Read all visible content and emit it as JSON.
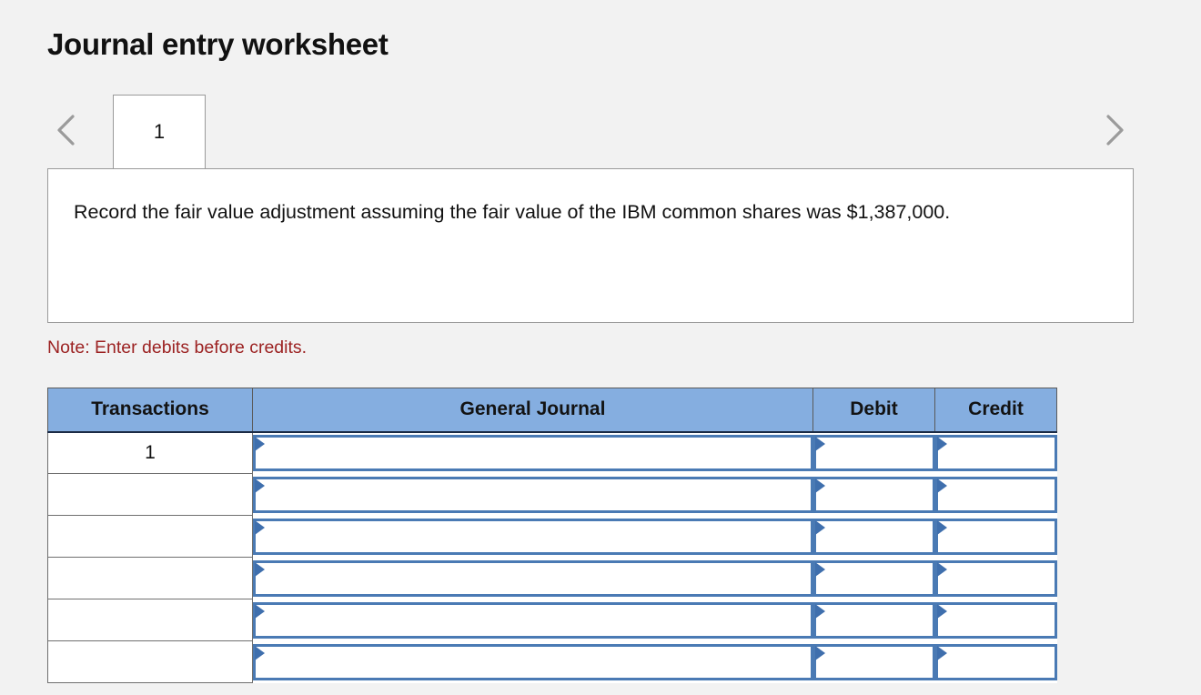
{
  "page_title": "Journal entry worksheet",
  "navigation": {
    "prev_label": "‹",
    "next_label": "›",
    "prev_icon": "chevron-left-icon",
    "next_icon": "chevron-right-icon",
    "tabs": [
      {
        "label": "1",
        "active": true
      }
    ]
  },
  "requirement": {
    "text": "Record the fair value adjustment assuming the fair value of the IBM common shares was $1,387,000."
  },
  "note": "Note: Enter debits before credits.",
  "table": {
    "headers": {
      "transactions": "Transactions",
      "general_journal": "General Journal",
      "debit": "Debit",
      "credit": "Credit"
    },
    "rows": [
      {
        "transaction": "1",
        "general_journal": "",
        "debit": "",
        "credit": ""
      },
      {
        "transaction": "",
        "general_journal": "",
        "debit": "",
        "credit": ""
      },
      {
        "transaction": "",
        "general_journal": "",
        "debit": "",
        "credit": ""
      },
      {
        "transaction": "",
        "general_journal": "",
        "debit": "",
        "credit": ""
      },
      {
        "transaction": "",
        "general_journal": "",
        "debit": "",
        "credit": ""
      },
      {
        "transaction": "",
        "general_journal": "",
        "debit": "",
        "credit": ""
      }
    ]
  },
  "colors": {
    "header_blue": "#85aee0",
    "field_border_blue": "#4a7ab4",
    "marker_blue": "#3f6fad",
    "note_red": "#9c2222",
    "page_background": "#f2f2f2"
  }
}
